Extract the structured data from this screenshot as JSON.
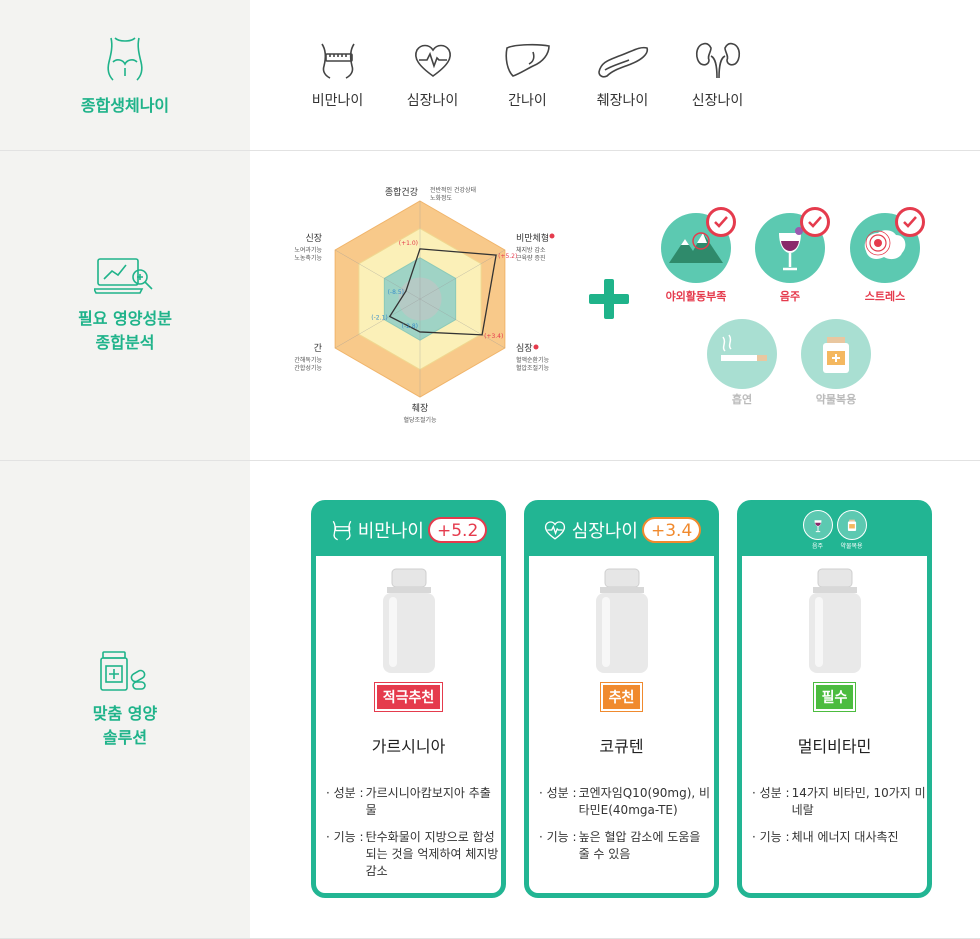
{
  "row1": {
    "title": "종합생체나이",
    "organs": [
      {
        "label": "비만나이",
        "icon": "waist-tape-icon"
      },
      {
        "label": "심장나이",
        "icon": "heart-pulse-icon"
      },
      {
        "label": "간나이",
        "icon": "liver-icon"
      },
      {
        "label": "췌장나이",
        "icon": "pancreas-icon"
      },
      {
        "label": "신장나이",
        "icon": "kidney-icon"
      }
    ]
  },
  "row2": {
    "title_line1": "필요 영양성분",
    "title_line2": "종합분석",
    "radar": {
      "axes": [
        {
          "name": "종합건강",
          "sub1": "전반적인 건강상태",
          "sub2": "노화정도"
        },
        {
          "name": "비만체형",
          "sub1": "체지방 감소",
          "sub2": "근육량 증진"
        },
        {
          "name": "심장",
          "sub1": "혈액순환기능",
          "sub2": "혈압조절기능"
        },
        {
          "name": "췌장",
          "sub1": "혈당조절기능",
          "sub2": ""
        },
        {
          "name": "간",
          "sub1": "간해독기능",
          "sub2": "간합성기능"
        },
        {
          "name": "신장",
          "sub1": "노여과기능",
          "sub2": "노농축기능"
        }
      ],
      "values": [
        "(+1.0)",
        "(+5.2)",
        "(+3.4)",
        "(-2.8)",
        "(-2.1)",
        "(-8.5)"
      ],
      "numeric": [
        1.0,
        5.2,
        3.4,
        -2.8,
        -2.1,
        -8.5
      ]
    },
    "factors": [
      {
        "label": "야외활동부족",
        "active": true
      },
      {
        "label": "음주",
        "active": true
      },
      {
        "label": "스트레스",
        "active": true
      },
      {
        "label": "흡연",
        "active": false
      },
      {
        "label": "약물복용",
        "active": false
      }
    ],
    "colors": {
      "active": "#e53b4d",
      "inactive": "#bbbbbb",
      "teal": "#5cc9b1"
    }
  },
  "row3": {
    "title_line1": "맞춤 영양",
    "title_line2": "솔루션",
    "cards": [
      {
        "head": "비만나이",
        "value": "+5.2",
        "tag": "적극추천",
        "name": "가르시니아",
        "d1k": "· 성분 : ",
        "d1v": "가르시니아캄보지아 추출물",
        "d2k": "· 기능 : ",
        "d2v": "탄수화물이 지방으로 합성되는 것을 억제하여 체지방 감소"
      },
      {
        "head": "심장나이",
        "value": "+3.4",
        "tag": "추천",
        "name": "코큐텐",
        "d1k": "· 성분 : ",
        "d1v": "코엔자임Q10(90mg), 비타민E(40mga-TE)",
        "d2k": "· 기능 : ",
        "d2v": "높은 혈압 감소에 도움을 줄 수 있음"
      },
      {
        "head_icon1": "음주",
        "head_icon2": "약물복용",
        "tag": "필수",
        "name": "멀티비타민",
        "d1k": "· 성분 : ",
        "d1v": "14가지 비타민, 10가지 미네랄",
        "d2k": "· 기능 : ",
        "d2v": "체내 에너지 대사촉진"
      }
    ],
    "colors": {
      "card": "#22b593",
      "red": "#e53b4d",
      "orange": "#f08a2e",
      "green": "#4cbc3f"
    }
  }
}
